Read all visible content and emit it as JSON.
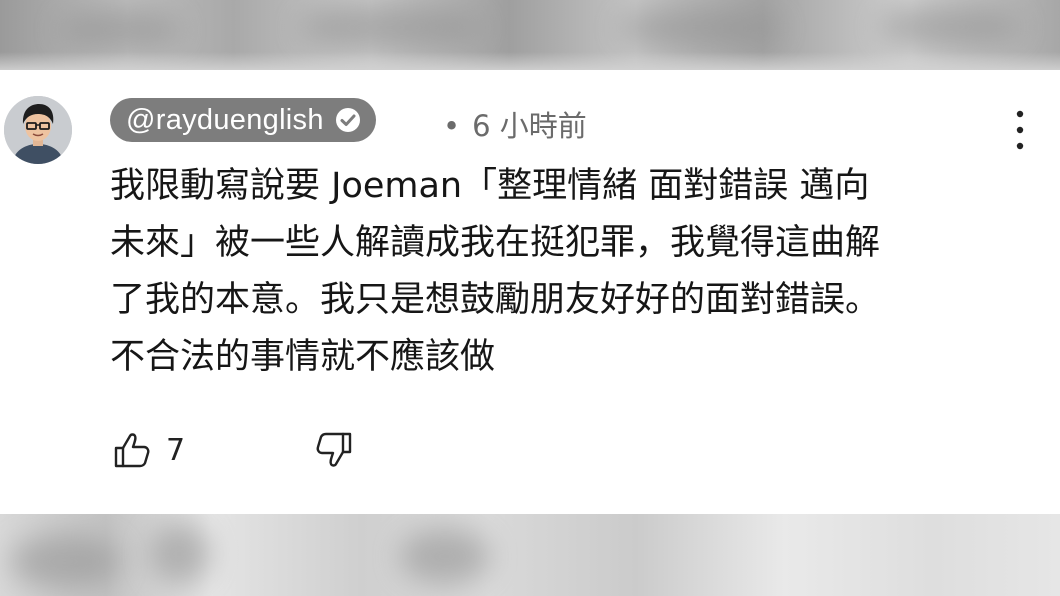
{
  "comment": {
    "username": "@rayduenglish",
    "separator": "•",
    "timestamp": "6 小時前",
    "text": "我限動寫說要 Joeman「整理情緒 面對錯誤 邁向\n未來」被一些人解讀成我在挺犯罪，我覺得這曲解\n了我的本意。我只是想鼓勵朋友好好的面對錯誤。\n不合法的事情就不應該做",
    "like_count": "7"
  },
  "icons": {
    "verified": "verified-check-icon",
    "more": "more-vertical-icon",
    "like": "thumbs-up-icon",
    "dislike": "thumbs-down-icon"
  },
  "colors": {
    "username_pill": "#7d7d7d",
    "meta_text": "#6b6b6b",
    "body_text": "#161616"
  }
}
